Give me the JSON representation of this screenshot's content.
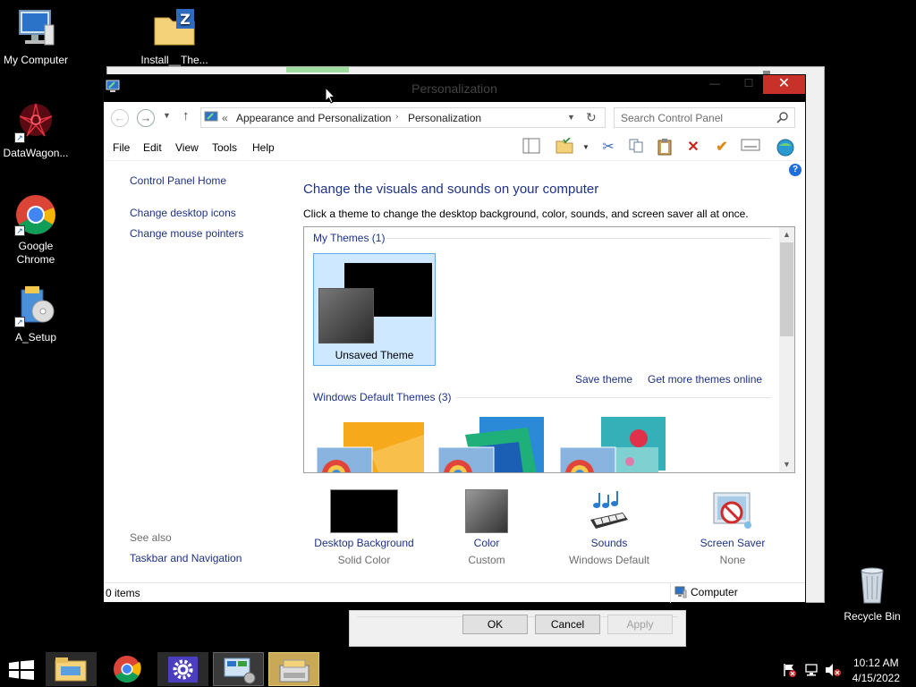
{
  "desktop": {
    "icons": [
      {
        "label": "My Computer"
      },
      {
        "label": "Install__The..."
      },
      {
        "label": "DataWagon..."
      },
      {
        "label": "Google Chrome"
      },
      {
        "label": "A_Setup"
      },
      {
        "label": "Recycle Bin"
      }
    ]
  },
  "window": {
    "title": "Personalization",
    "breadcrumb": {
      "prefix": "«",
      "items": [
        "Appearance and Personalization",
        "Personalization"
      ]
    },
    "search_placeholder": "Search Control Panel",
    "menu": [
      "File",
      "Edit",
      "View",
      "Tools",
      "Help"
    ],
    "sidebar": {
      "home": "Control Panel Home",
      "links": [
        "Change desktop icons",
        "Change mouse pointers"
      ],
      "see_also_label": "See also",
      "see_also_links": [
        "Taskbar and Navigation"
      ]
    },
    "main": {
      "heading": "Change the visuals and sounds on your computer",
      "subheading": "Click a theme to change the desktop background, color, sounds, and screen saver all at once.",
      "my_themes_label": "My Themes (1)",
      "unsaved_theme_label": "Unsaved Theme",
      "save_theme": "Save theme",
      "get_more": "Get more themes online",
      "default_themes_label": "Windows Default Themes (3)"
    },
    "bottom_items": [
      {
        "title": "Desktop Background",
        "sub": "Solid Color"
      },
      {
        "title": "Color",
        "sub": "Custom"
      },
      {
        "title": "Sounds",
        "sub": "Windows Default"
      },
      {
        "title": "Screen Saver",
        "sub": "None"
      }
    ],
    "status": {
      "items": "0 items",
      "location": "Computer"
    }
  },
  "dialog_buttons": {
    "ok": "OK",
    "cancel": "Cancel",
    "apply": "Apply"
  },
  "taskbar": {
    "time": "10:12 AM",
    "date": "4/15/2022"
  },
  "colors": {
    "link": "#1e3287",
    "close_red": "#c7312a",
    "selection": "#cde8ff"
  }
}
